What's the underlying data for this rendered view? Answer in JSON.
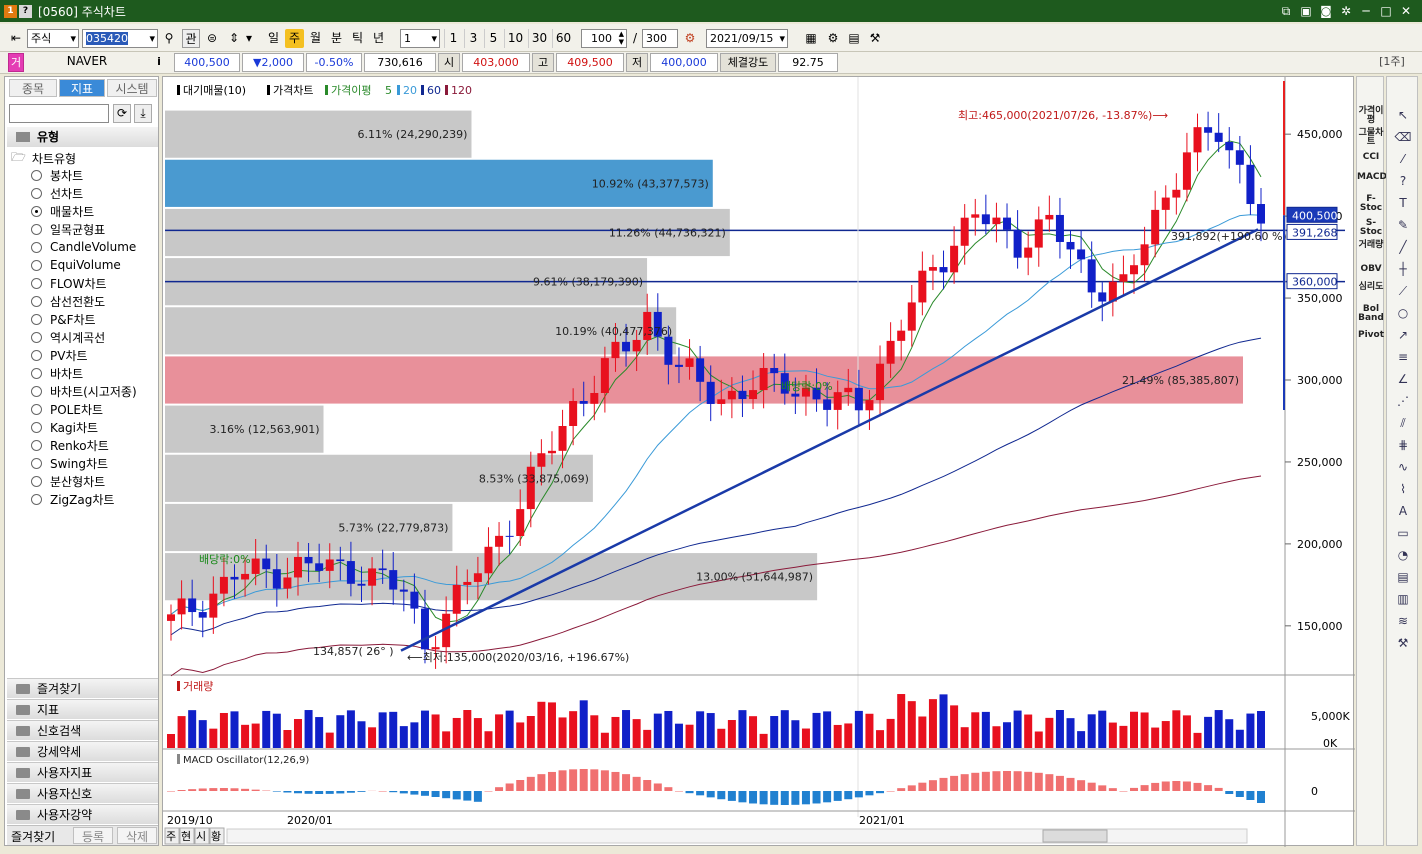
{
  "window": {
    "title": "[0560] 주식차트",
    "icon_primary": "1",
    "icon_help": "?"
  },
  "toolbar": {
    "market": "주식",
    "code": "035420",
    "buttons": {
      "jump": "관"
    },
    "periods": [
      "일",
      "주",
      "월",
      "분",
      "틱",
      "년"
    ],
    "active_period": "주",
    "interval": "1",
    "quick_intervals": [
      "1",
      "3",
      "5",
      "10",
      "30",
      "60"
    ],
    "display_count": "100",
    "total_count": "300",
    "count_separator": "/",
    "date": "2021/09/15"
  },
  "quote": {
    "badge": "거",
    "name": "NAVER",
    "info": "i",
    "price": "400,500",
    "change": "▼2,000",
    "change_pct": "-0.50%",
    "volume": "730,616",
    "open_label": "시",
    "open": "403,000",
    "high_label": "고",
    "high": "409,500",
    "low_label": "저",
    "low": "400,000",
    "strength_label": "체결강도",
    "strength": "92.75",
    "period_badge": "[1주]"
  },
  "sidebar": {
    "tabs": [
      "종목",
      "지표",
      "시스템"
    ],
    "active_tab": "지표",
    "section_title": "유형",
    "tree_root": "차트유형",
    "chart_types": [
      "봉차트",
      "선차트",
      "매물차트",
      "일목균형표",
      "CandleVolume",
      "EquiVolume",
      "FLOW차트",
      "삼선전환도",
      "P&F차트",
      "역시계곡선",
      "PV차트",
      "바차트",
      "바차트(시고저종)",
      "POLE차트",
      "Kagi차트",
      "Renko차트",
      "Swing차트",
      "분산형차트",
      "ZigZag차트"
    ],
    "selected_type": "매물차트",
    "folders": [
      "즐겨찾기",
      "지표",
      "신호검색",
      "강세약세",
      "사용자지표",
      "사용자신호",
      "사용자강약"
    ],
    "bottom_buttons": [
      "즐겨찾기",
      "등록",
      "삭제"
    ]
  },
  "chart": {
    "legend": {
      "vp": "대기매물(10)",
      "price": "가격차트",
      "ma_label": "가격이평",
      "ma1": "5",
      "ma2": "20",
      "ma3": "60",
      "ma4": "120"
    },
    "colors": {
      "up": "#e8101e",
      "down": "#1020c8",
      "ma5": "#2a8a2a",
      "ma20": "#3a9ad8",
      "ma60": "#102890",
      "ma120": "#8a1a3a",
      "vp_gray": "#c8c8c8",
      "vp_blue": "#4a9ad0",
      "vp_red": "#e8909a"
    },
    "high_annotation": "최고:465,000(2021/07/26, -13.87%)⟶",
    "low_annotation": "⟵최저:135,000(2020/03/16, +196.67%)",
    "trend_label": "391,892(+190.60 %)",
    "trend_start_label": "134,857( 26° )",
    "dividend_labels": [
      "배당락:0%",
      "배당락:0%"
    ],
    "price_tags": {
      "current": "400,500",
      "trend": "391,268",
      "line": "360,000"
    },
    "price_axis": [
      "450,000",
      "400,000",
      "350,000",
      "300,000",
      "250,000",
      "200,000",
      "150,000"
    ],
    "volume_title": "거래량",
    "volume_axis": [
      "5,000K",
      "0K"
    ],
    "macd_title": "MACD Oscillator(12,26,9)",
    "macd_axis": [
      "0"
    ],
    "x_labels": [
      "2019/10",
      "2020/01",
      "2021/01"
    ],
    "bottom_tabs": [
      "주",
      "현",
      "시",
      "황"
    ]
  },
  "chart_data": {
    "type": "bar",
    "volume_profile": [
      {
        "label": "6.11% (24,290,239)",
        "pct": 6.11
      },
      {
        "label": "10.92% (43,377,573)",
        "pct": 10.92
      },
      {
        "label": "11.26% (44,736,321)",
        "pct": 11.26
      },
      {
        "label": "9.61% (38,179,390)",
        "pct": 9.61
      },
      {
        "label": "10.19% (40,477,376)",
        "pct": 10.19
      },
      {
        "label": "21.49% (85,385,807)",
        "pct": 21.49
      },
      {
        "label": "3.16% (12,563,901)",
        "pct": 3.16
      },
      {
        "label": "8.53% (33,875,069)",
        "pct": 8.53
      },
      {
        "label": "5.73% (22,779,873)",
        "pct": 5.73
      },
      {
        "label": "13.00% (51,644,987)",
        "pct": 13.0
      }
    ],
    "ylim": [
      120000,
      480000
    ],
    "high": 465000,
    "low": 135000
  },
  "right_panel": {
    "indicators": [
      "가격이평",
      "그물차트",
      "CCI",
      "MACD",
      "F-Stoc",
      "S-Stoc",
      "거래량",
      "OBV",
      "심리도",
      "Bol Band",
      "Pivot"
    ]
  }
}
